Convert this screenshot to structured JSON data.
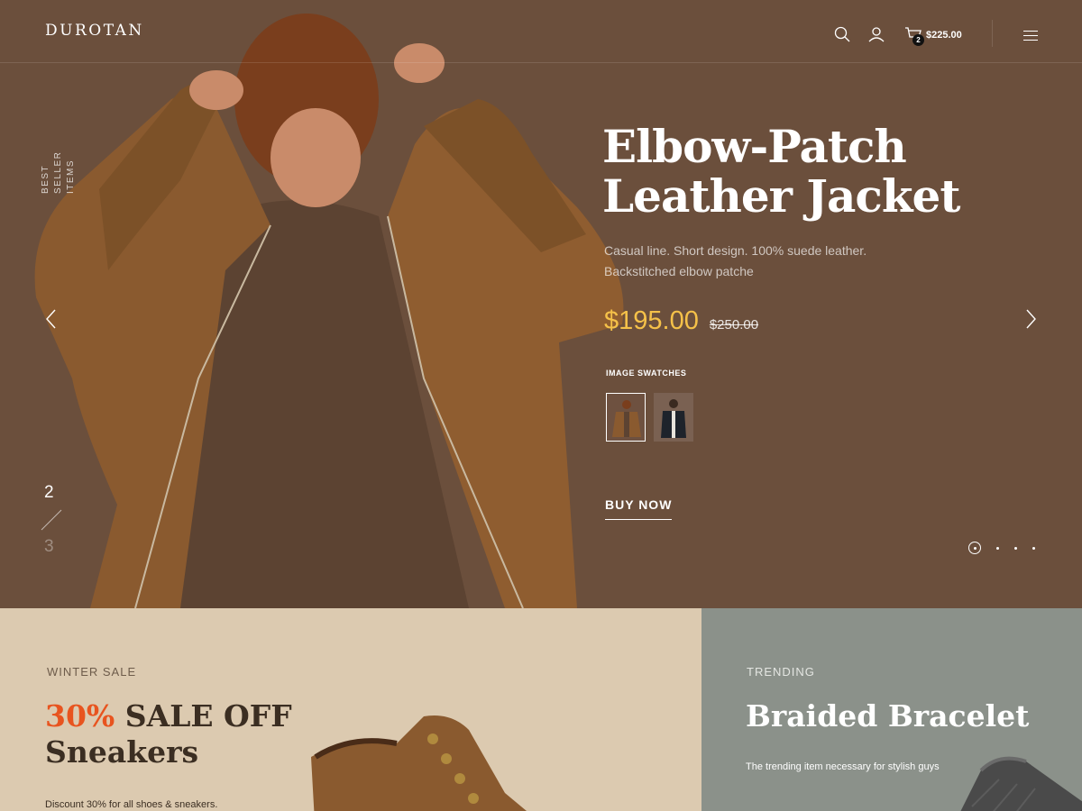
{
  "header": {
    "logo": "DUROTAN",
    "cart_count": "2",
    "cart_total": "$225.00"
  },
  "icons": [
    "search-icon",
    "user-icon",
    "cart-icon",
    "menu-icon",
    "chevron-left-icon",
    "chevron-right-icon"
  ],
  "hero": {
    "vertical_label_line1": "BEST SELLER",
    "vertical_label_line2": "ITEMS",
    "title_line1": "Elbow-Patch",
    "title_line2": "Leather Jacket",
    "description": "Casual line. Short design. 100% suede leather. Backstitched elbow patche",
    "price": "$195.00",
    "old_price": "$250.00",
    "swatches_label": "IMAGE SWATCHES",
    "buy_label": "BUY NOW",
    "slide_current": "2",
    "slide_next": "3",
    "dots_total": 4,
    "dot_active_index": 0
  },
  "banner_left": {
    "eyebrow": "WINTER SALE",
    "title_accent": "30%",
    "title_rest": " SALE OFF",
    "title_line2": "Sneakers",
    "description": "Discount 30% for all shoes & sneakers."
  },
  "banner_right": {
    "eyebrow": "TRENDING",
    "title": "Braided Bracelet",
    "description": "The trending item necessary for stylish guys"
  },
  "colors": {
    "hero_bg": "#6b4f3c",
    "price": "#f5c149",
    "accent_orange": "#e8541f",
    "banner_left_bg": "#dccab0",
    "banner_right_bg": "#8b918a"
  }
}
